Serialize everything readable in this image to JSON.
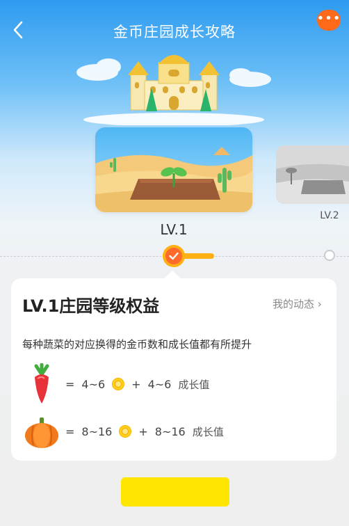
{
  "header": {
    "title": "金币庄园成长攻略",
    "back_icon": "chevron-left-icon",
    "more_icon": "more-dots-icon",
    "more_dots": "•••",
    "accent_color": "#ff6a1a"
  },
  "levels": [
    {
      "label": "LV.1",
      "state": "current"
    },
    {
      "label": "LV.2",
      "state": "locked"
    }
  ],
  "progress": {
    "current_level": 1
  },
  "benefit": {
    "title": "LV.1庄园等级权益",
    "link_label": "我的动态 ›",
    "description": "每种蔬菜的对应换得的金币数和成长值都有所提升",
    "rewards": [
      {
        "item_icon": "radish-icon",
        "coins": "4~6",
        "growth": "4~6",
        "growth_label": "成长值"
      },
      {
        "item_icon": "pumpkin-icon",
        "coins": "8~16",
        "growth": "8~16",
        "growth_label": "成长值"
      }
    ],
    "equals": "=",
    "plus": "+"
  },
  "colors": {
    "primary_yellow": "#ffe600",
    "orange": "#ff6a2a",
    "sky": "#2e9bf0"
  }
}
